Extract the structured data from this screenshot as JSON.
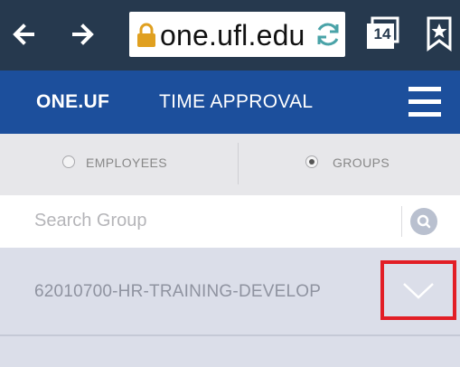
{
  "browser": {
    "url": "one.ufl.edu",
    "tab_count": "14"
  },
  "header": {
    "brand": "ONE.UF",
    "title": "TIME APPROVAL"
  },
  "view_toggle": {
    "options": [
      {
        "label": "EMPLOYEES",
        "selected": false
      },
      {
        "label": "GROUPS",
        "selected": true
      }
    ]
  },
  "search": {
    "placeholder": "Search Group",
    "value": ""
  },
  "groups": [
    {
      "name": "62010700-HR-TRAINING-DEVELOP",
      "expand_icon": "chevron-down-icon"
    }
  ],
  "colors": {
    "browser_bar": "#26394e",
    "app_header": "#1c4f9c",
    "highlight_box": "#e21e26",
    "group_row": "#dbdee9"
  }
}
